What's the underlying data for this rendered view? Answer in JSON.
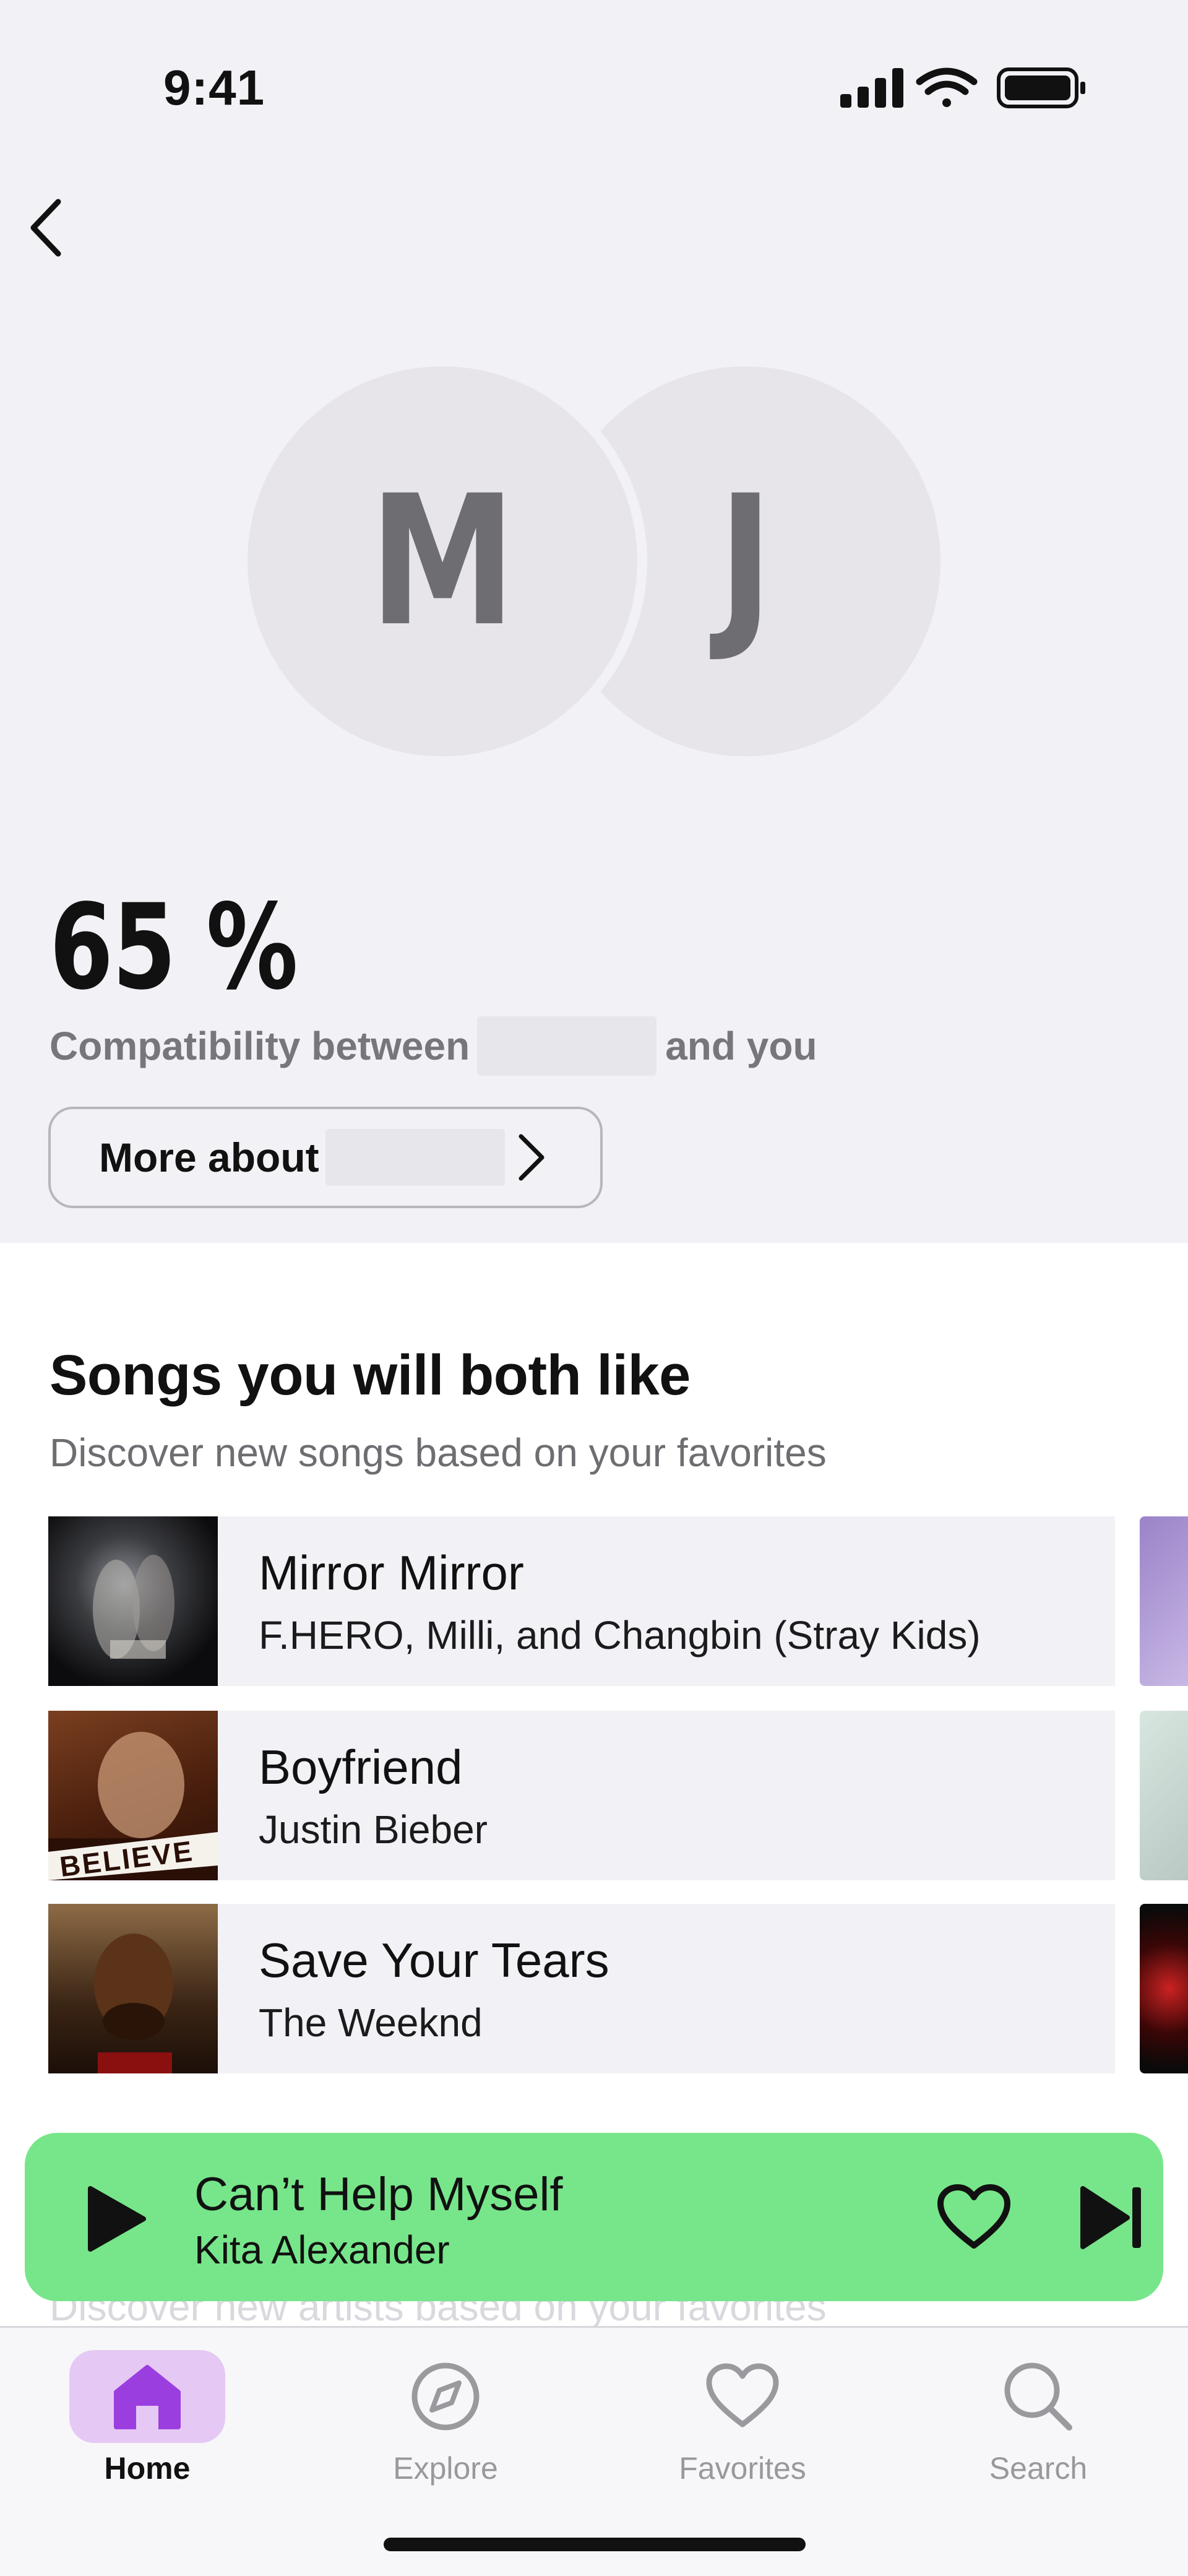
{
  "status_bar": {
    "time": "9:41"
  },
  "header": {
    "back_icon": "chevron-left-icon"
  },
  "avatars": [
    {
      "initial": "M",
      "color": "#e7e5ea"
    },
    {
      "initial": "J",
      "color": "#e7e5ea"
    }
  ],
  "compatibility": {
    "percent": "65 %",
    "text_before": "Compatibility between",
    "text_after": "and you",
    "more_button_label": "More about"
  },
  "songs_section": {
    "title": "Songs you will both like",
    "subtitle": "Discover new songs based on your favorites",
    "songs": [
      {
        "title": "Mirror Mirror",
        "artist": "F.HERO, Milli, and Changbin (Stray Kids)"
      },
      {
        "title": "Boyfriend",
        "artist": "Justin Bieber",
        "art_text": "BELIEVE"
      },
      {
        "title": "Save Your Tears",
        "artist": "The Weeknd"
      }
    ]
  },
  "hidden_text": "Discover new artists based on your favorites",
  "player": {
    "title": "Can’t Help Myself",
    "artist": "Kita Alexander",
    "background": "#77e68a"
  },
  "tabs": [
    {
      "label": "Home",
      "icon": "home-icon",
      "active": true
    },
    {
      "label": "Explore",
      "icon": "compass-icon",
      "active": false
    },
    {
      "label": "Favorites",
      "icon": "heart-icon",
      "active": false
    },
    {
      "label": "Search",
      "icon": "search-icon",
      "active": false
    }
  ],
  "colors": {
    "accent": "#9b3ee0",
    "active_tab_bg": "#e5c8f3",
    "top_bg": "#f2f1f5"
  }
}
